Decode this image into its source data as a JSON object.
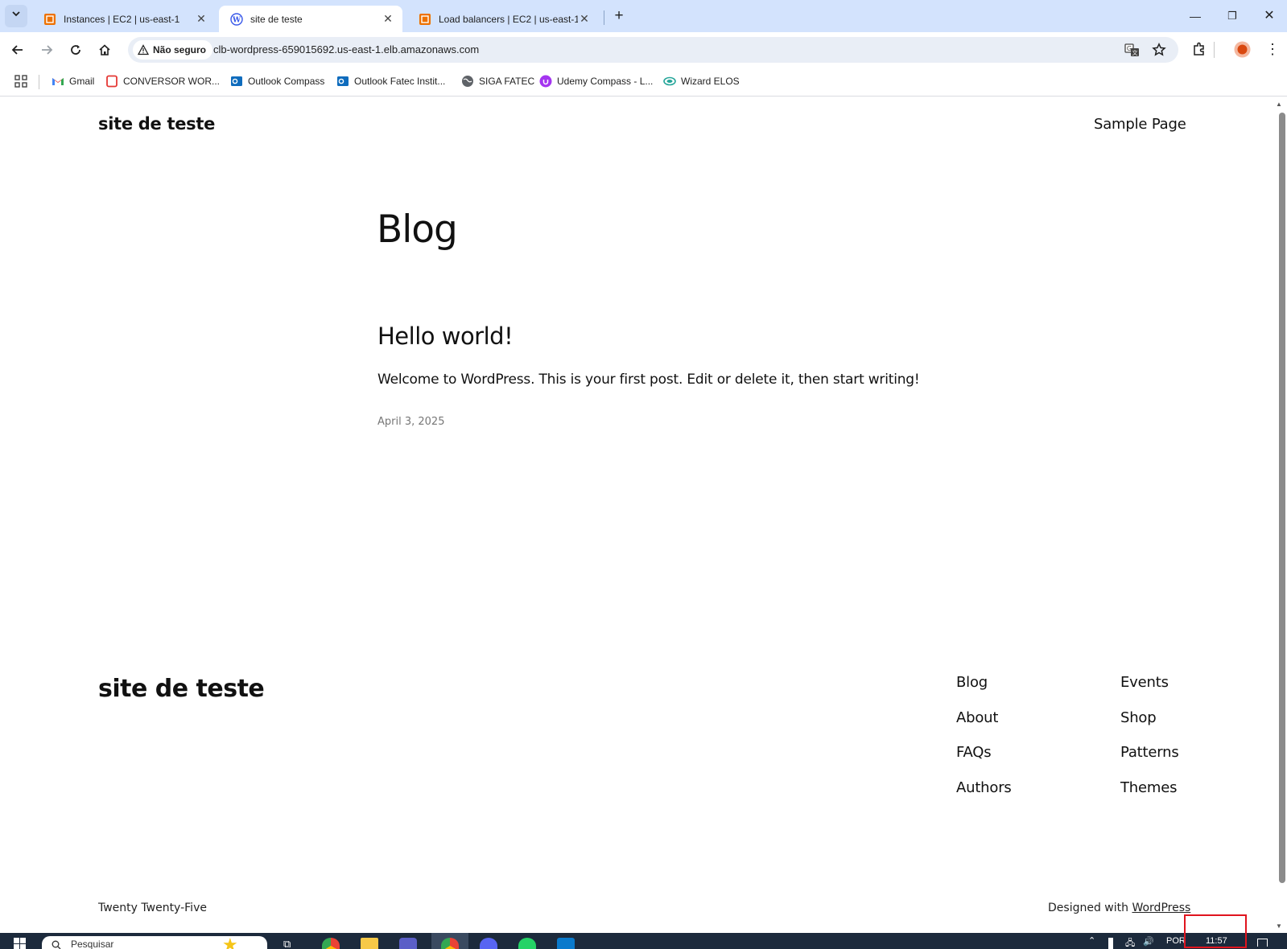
{
  "browser": {
    "tabs": [
      {
        "label": "Instances | EC2 | us-east-1",
        "active": false,
        "icon": "aws-icon"
      },
      {
        "label": "site de teste",
        "active": true,
        "icon": "wordpress-icon"
      },
      {
        "label": "Load balancers | EC2 | us-east-1",
        "active": false,
        "icon": "aws-icon"
      }
    ],
    "security_label": "Não seguro",
    "url": "clb-wordpress-659015692.us-east-1.elb.amazonaws.com",
    "bookmarks": [
      {
        "label": "Gmail",
        "icon": "gmail-icon"
      },
      {
        "label": "CONVERSOR WOR...",
        "icon": "converter-icon"
      },
      {
        "label": "Outlook Compass",
        "icon": "outlook-icon"
      },
      {
        "label": "Outlook Fatec Instit...",
        "icon": "outlook-icon"
      },
      {
        "label": "SIGA FATEC",
        "icon": "globe-icon"
      },
      {
        "label": "Udemy Compass - L...",
        "icon": "udemy-icon"
      },
      {
        "label": "Wizard ELOS",
        "icon": "wizard-icon"
      }
    ]
  },
  "site": {
    "title": "site de teste",
    "nav": {
      "sample_page": "Sample Page"
    },
    "heading": "Blog",
    "post": {
      "title": "Hello world!",
      "excerpt": "Welcome to WordPress. This is your first post. Edit or delete it, then start writing!",
      "date": "April 3, 2025"
    },
    "footer": {
      "title": "site de teste",
      "links_col1": [
        "Blog",
        "About",
        "FAQs",
        "Authors"
      ],
      "links_col2": [
        "Events",
        "Shop",
        "Patterns",
        "Themes"
      ],
      "theme": "Twenty Twenty-Five",
      "designed_prefix": "Designed with",
      "designed_link": "WordPress"
    }
  },
  "taskbar": {
    "search_placeholder": "Pesquisar",
    "language": "POR",
    "clock": "11:57"
  },
  "colors": {
    "tabstrip": "#d3e3fd",
    "taskbar": "#1c2a3c",
    "highlight": "#e0141e"
  }
}
